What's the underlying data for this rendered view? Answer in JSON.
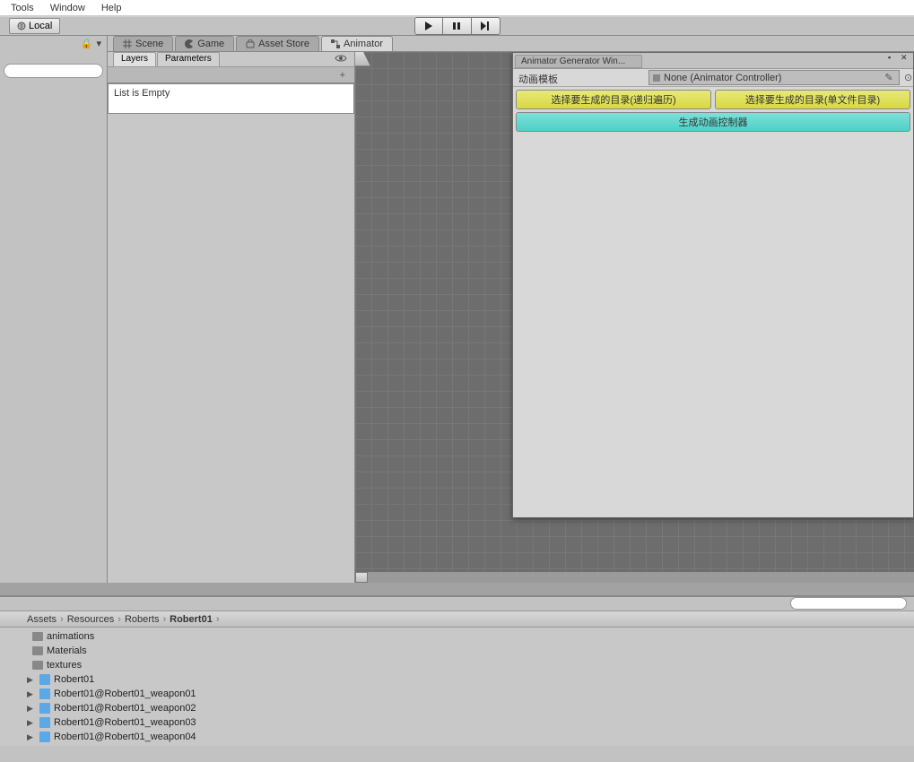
{
  "menu": {
    "tools": "Tools",
    "window": "Window",
    "help": "Help"
  },
  "toolbar": {
    "local": "Local"
  },
  "tabs": {
    "scene": "Scene",
    "game": "Game",
    "asset_store": "Asset Store",
    "animator": "Animator"
  },
  "animator": {
    "subtabs": {
      "layers": "Layers",
      "parameters": "Parameters"
    },
    "empty": "List is Empty"
  },
  "float_window": {
    "title": "Animator Generator Win...",
    "field_label": "动画模板",
    "field_value": "None (Animator Controller)",
    "btn_recursive": "选择要生成的目录(递归遍历)",
    "btn_singlefile": "选择要生成的目录(单文件目录)",
    "btn_generate": "生成动画控制器"
  },
  "project": {
    "breadcrumb": [
      "Assets",
      "Resources",
      "Roberts",
      "Robert01"
    ],
    "folders": [
      "animations",
      "Materials",
      "textures"
    ],
    "prefabs": [
      "Robert01",
      "Robert01@Robert01_weapon01",
      "Robert01@Robert01_weapon02",
      "Robert01@Robert01_weapon03",
      "Robert01@Robert01_weapon04"
    ]
  }
}
